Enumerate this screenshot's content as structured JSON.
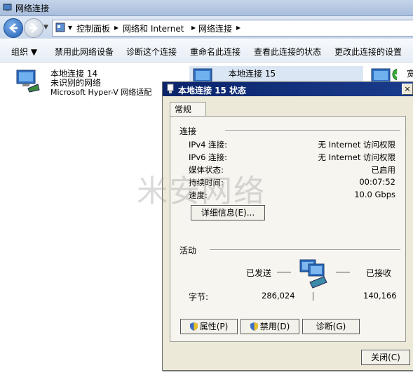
{
  "window": {
    "title": "网络连接"
  },
  "address": {
    "crumbs": [
      "控制面板",
      "网络和 Internet",
      "网络连接"
    ],
    "sep": "▸",
    "dropdown": "▾"
  },
  "toolbar": {
    "organize": "组织 ▼",
    "disable": "禁用此网络设备",
    "diagnose": "诊断这个连接",
    "rename": "重命名此连接",
    "view_status": "查看此连接的状态",
    "change_settings": "更改此连接的设置"
  },
  "items": [
    {
      "name": "本地连接 14",
      "status": "未识别的网络",
      "adapter": "Microsoft Hyper-V 网络适配"
    },
    {
      "name": "本地连接 15"
    },
    {
      "name": "宽"
    }
  ],
  "dialog": {
    "title": "本地连接 15 状态",
    "close_glyph": "×",
    "tab": "常规",
    "connection_section": "连接",
    "rows": [
      {
        "label": "IPv4 连接:",
        "value": "无 Internet 访问权限"
      },
      {
        "label": "IPv6 连接:",
        "value": "无 Internet 访问权限"
      },
      {
        "label": "媒体状态:",
        "value": "已启用"
      },
      {
        "label": "持续时间:",
        "value": "00:07:52"
      },
      {
        "label": "速度:",
        "value": "10.0 Gbps"
      }
    ],
    "details_button": "详细信息(E)...",
    "activity_section": "活动",
    "sent_label": "已发送",
    "received_label": "已接收",
    "bytes_label": "字节:",
    "bytes_sent": "286,024",
    "bytes_received": "140,166",
    "properties_button": "属性(P)",
    "disable_button": "禁用(D)",
    "diagnose_button": "诊断(G)",
    "close_button": "关闭(C)"
  },
  "watermark": "米安网络",
  "colors": {
    "dialog_title_bg": "#0a246a",
    "dialog_face": "#ece9d8",
    "selection": "#dbe6f4"
  }
}
